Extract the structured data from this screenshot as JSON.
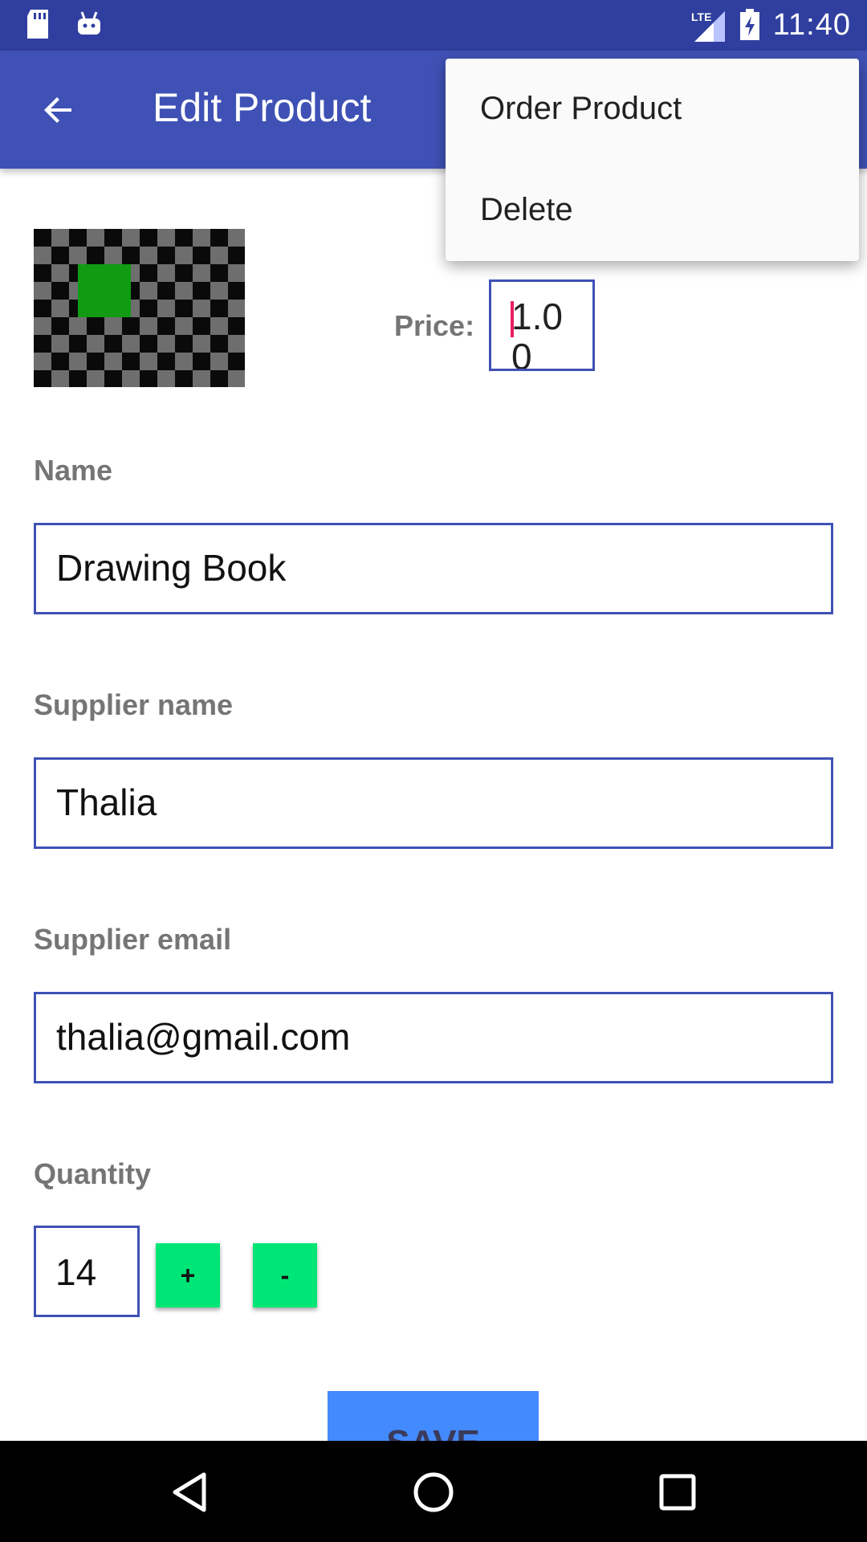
{
  "status_bar": {
    "time": "11:40",
    "network": "LTE",
    "icons": [
      "sd-card-icon",
      "android-icon",
      "lte-signal-icon",
      "battery-charging-icon"
    ]
  },
  "app_bar": {
    "title": "Edit Product",
    "back_icon": "arrow-back-icon"
  },
  "product": {
    "image_icon": "checkerboard-placeholder-image",
    "price_label": "Price:",
    "price_value": "1.0\n0"
  },
  "fields": {
    "name_label": "Name",
    "name_value": "Drawing Book",
    "supplier_name_label": "Supplier name",
    "supplier_name_value": "Thalia",
    "supplier_email_label": "Supplier email",
    "supplier_email_value": "thalia@gmail.com",
    "quantity_label": "Quantity",
    "quantity_value": "14",
    "increment_label": "+",
    "decrement_label": "-"
  },
  "save_label": "SAVE",
  "menu": {
    "items": [
      {
        "label": "Order Product"
      },
      {
        "label": "Delete"
      }
    ]
  },
  "colors": {
    "status_bar": "#303f9f",
    "app_bar": "#3f51b5",
    "accent_green": "#00e676",
    "save_blue": "#448aff",
    "cursor_pink": "#e91e63"
  },
  "nav_bar": {
    "icons": [
      "back-triangle-icon",
      "home-circle-icon",
      "recents-square-icon"
    ]
  }
}
